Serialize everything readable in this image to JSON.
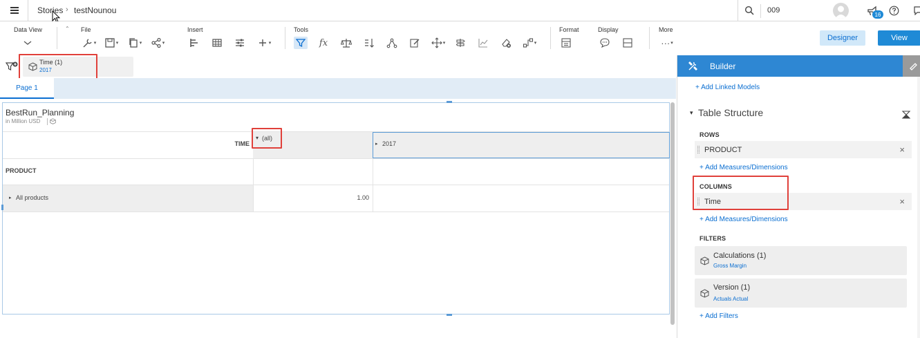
{
  "topbar": {
    "menu_icon": "hamburger-icon",
    "breadcrumb_root": "Stories",
    "breadcrumb_current": "testNounou",
    "search_value": "009",
    "notification_count": "16"
  },
  "toolbar": {
    "groups": {
      "data_view": "Data View",
      "file": "File",
      "insert": "Insert",
      "tools": "Tools",
      "format": "Format",
      "display": "Display",
      "more": "More"
    },
    "designer_label": "Designer",
    "view_label": "View"
  },
  "filterbar": {
    "chip_title": "Time (1)",
    "chip_value": "2017"
  },
  "pages": {
    "active_tab": "Page 1"
  },
  "table": {
    "title": "BestRun_Planning",
    "subtitle": "in Million USD",
    "col_dim_label": "TIME",
    "col_all_label": "(all)",
    "col_2017_label": "2017",
    "row_dim_label": "PRODUCT",
    "row_member": "All products",
    "row_value": "1.00"
  },
  "builder": {
    "title": "Builder",
    "add_linked_models": "+ Add Linked Models",
    "table_structure": "Table Structure",
    "rows_label": "ROWS",
    "rows_item": "PRODUCT",
    "add_measures_dims_rows": "+ Add Measures/Dimensions",
    "columns_label": "COLUMNS",
    "columns_item": "Time",
    "add_measures_dims_cols": "+ Add Measures/Dimensions",
    "filters_label": "FILTERS",
    "filter1_title": "Calculations (1)",
    "filter1_value": "Gross Margin",
    "filter2_title": "Version (1)",
    "filter2_value": "Actuals Actual",
    "add_filters": "+ Add Filters"
  },
  "colors": {
    "accent": "#0a6ed1",
    "builder_header": "#2e87d3",
    "highlight_box": "#e0403a"
  }
}
